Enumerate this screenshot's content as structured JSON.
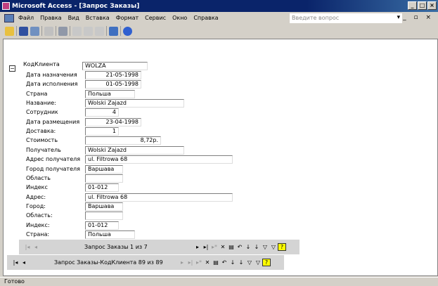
{
  "window": {
    "title": "Microsoft Access - [Запрос Заказы]"
  },
  "menu": [
    "Файл",
    "Правка",
    "Вид",
    "Вставка",
    "Формат",
    "Сервис",
    "Окно",
    "Справка"
  ],
  "help_placeholder": "Введите вопрос",
  "form": {
    "customer_label": "КодКлиента",
    "customer_value": "WOLZA",
    "fields": [
      {
        "label": "Дата назначения",
        "value": "21-05-1998"
      },
      {
        "label": "Дата исполнения",
        "value": "01-05-1998"
      },
      {
        "label": "Страна",
        "value": "Польша"
      },
      {
        "label": "Название:",
        "value": "Wolski  Zajazd"
      },
      {
        "label": "Сотрудник",
        "value": "4"
      },
      {
        "label": "Дата размещения",
        "value": "23-04-1998"
      },
      {
        "label": "Доставка:",
        "value": "1"
      },
      {
        "label": "Стоимость",
        "value": "8,72р."
      },
      {
        "label": "Получатель",
        "value": "Wolski Zajazd"
      },
      {
        "label": "Адрес получателя",
        "value": "ul. Filtrowa 68"
      },
      {
        "label": "Город получателя",
        "value": "Варшава"
      },
      {
        "label": "Область",
        "value": ""
      },
      {
        "label": "Индекс",
        "value": "01-012"
      },
      {
        "label": "Адрес:",
        "value": "ul. Filtrowa 68"
      },
      {
        "label": "Город:",
        "value": "Варшава"
      },
      {
        "label": "Область:",
        "value": ""
      },
      {
        "label": "Индекс:",
        "value": "01-012"
      },
      {
        "label": "Страна:",
        "value": "Польша"
      }
    ]
  },
  "nav_sub": {
    "text": "Запрос Заказы 1 из 7"
  },
  "nav_main": {
    "text": "Запрос Заказы-КодКлиента 89 из 89"
  },
  "status": "Готово"
}
